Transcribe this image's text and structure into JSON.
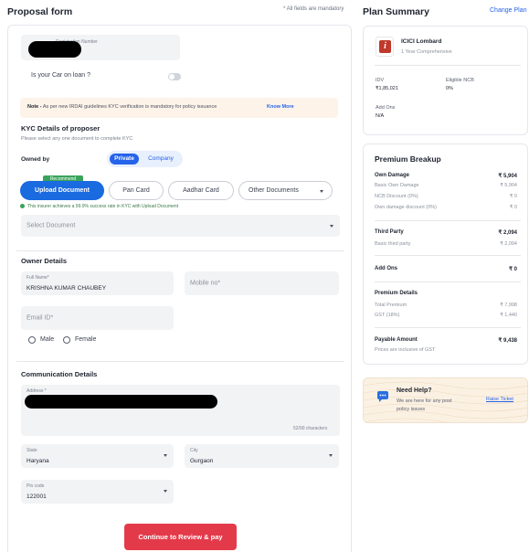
{
  "header": {
    "title": "Proposal form",
    "mandatory_note": "* All fields are mandatory"
  },
  "vehicle": {
    "registration_label": "Registration Number",
    "car_loan_label": "Is your Car on loan ?"
  },
  "kyc_note": {
    "prefix": "Note -",
    "text": "As per new IRDAI guidelines KYC verification is mandatory for policy issuance",
    "link": "Know More"
  },
  "kyc": {
    "heading": "KYC Details of proposer",
    "subtext": "Please select any one document to complete KYC",
    "owned_by_label": "Owned by",
    "owned_by_options": [
      "Private",
      "Company"
    ],
    "recommend_tag": "Recommend",
    "documents": [
      "Upload Document",
      "Pan Card",
      "Aadhar Card",
      "Other Documents"
    ],
    "success_text": "This insurer achieves a 99.9% success rate in KYC with Upload Document",
    "select_document_placeholder": "Select Document"
  },
  "owner": {
    "heading": "Owner Details",
    "full_name_label": "Full Name*",
    "full_name_value": "KRISHNA KUMAR CHAUBEY",
    "mobile_placeholder": "Mobile no*",
    "email_placeholder": "Email ID*",
    "gender_options": [
      "Male",
      "Female"
    ]
  },
  "communication": {
    "heading": "Communication Details",
    "address_label": "Address *",
    "char_count": "52/90 characters",
    "state_label": "State",
    "state_value": "Haryana",
    "city_label": "City",
    "city_value": "Gurgaon",
    "pincode_label": "Pin code",
    "pincode_value": "122001"
  },
  "cta": {
    "label": "Continue to Review & pay"
  },
  "plan_summary": {
    "title": "Plan Summary",
    "change_plan": "Change Plan",
    "insurer_name": "ICICI Lombard",
    "plan_type": "1 Year Comprehensive",
    "idv_label": "IDV",
    "idv_value": "₹1,85,021",
    "ncb_label": "Eligible NCB",
    "ncb_value": "0%",
    "addons_label": "Add Ons",
    "addons_value": "N/A"
  },
  "premium_breakup": {
    "title": "Premium Breakup",
    "own_damage": {
      "label": "Own Damage",
      "value": "₹ 5,904"
    },
    "own_damage_rows": [
      {
        "label": "Basic Own Damage",
        "value": "₹ 5,904"
      },
      {
        "label": "NCB Discount (0%)",
        "value": "₹ 0"
      },
      {
        "label": "Own damage discount (0%)",
        "value": "₹ 0"
      }
    ],
    "third_party": {
      "label": "Third Party",
      "value": "₹ 2,094"
    },
    "third_party_rows": [
      {
        "label": "Basic third party",
        "value": "₹ 2,094"
      }
    ],
    "add_ons": {
      "label": "Add Ons",
      "value": "₹ 0"
    },
    "premium_details": {
      "label": "Premium Details",
      "rows": [
        {
          "label": "Total Premium",
          "value": "₹ 7,998"
        },
        {
          "label": "GST (18%)",
          "value": "₹ 1,440"
        }
      ]
    },
    "payable": {
      "label": "Payable Amount",
      "value": "₹ 9,438",
      "note": "Prices are inclusive of GST"
    }
  },
  "help": {
    "title": "Need Help?",
    "text_line1": "We are here for any post",
    "text_line2": "policy issues",
    "link": "Raise Ticket"
  },
  "colors": {
    "primary_blue": "#2563eb",
    "cta_red": "#e33a4a",
    "success_green": "#3aa35a",
    "note_bg": "#fdf3e9",
    "help_bg": "#fbf1e3"
  }
}
